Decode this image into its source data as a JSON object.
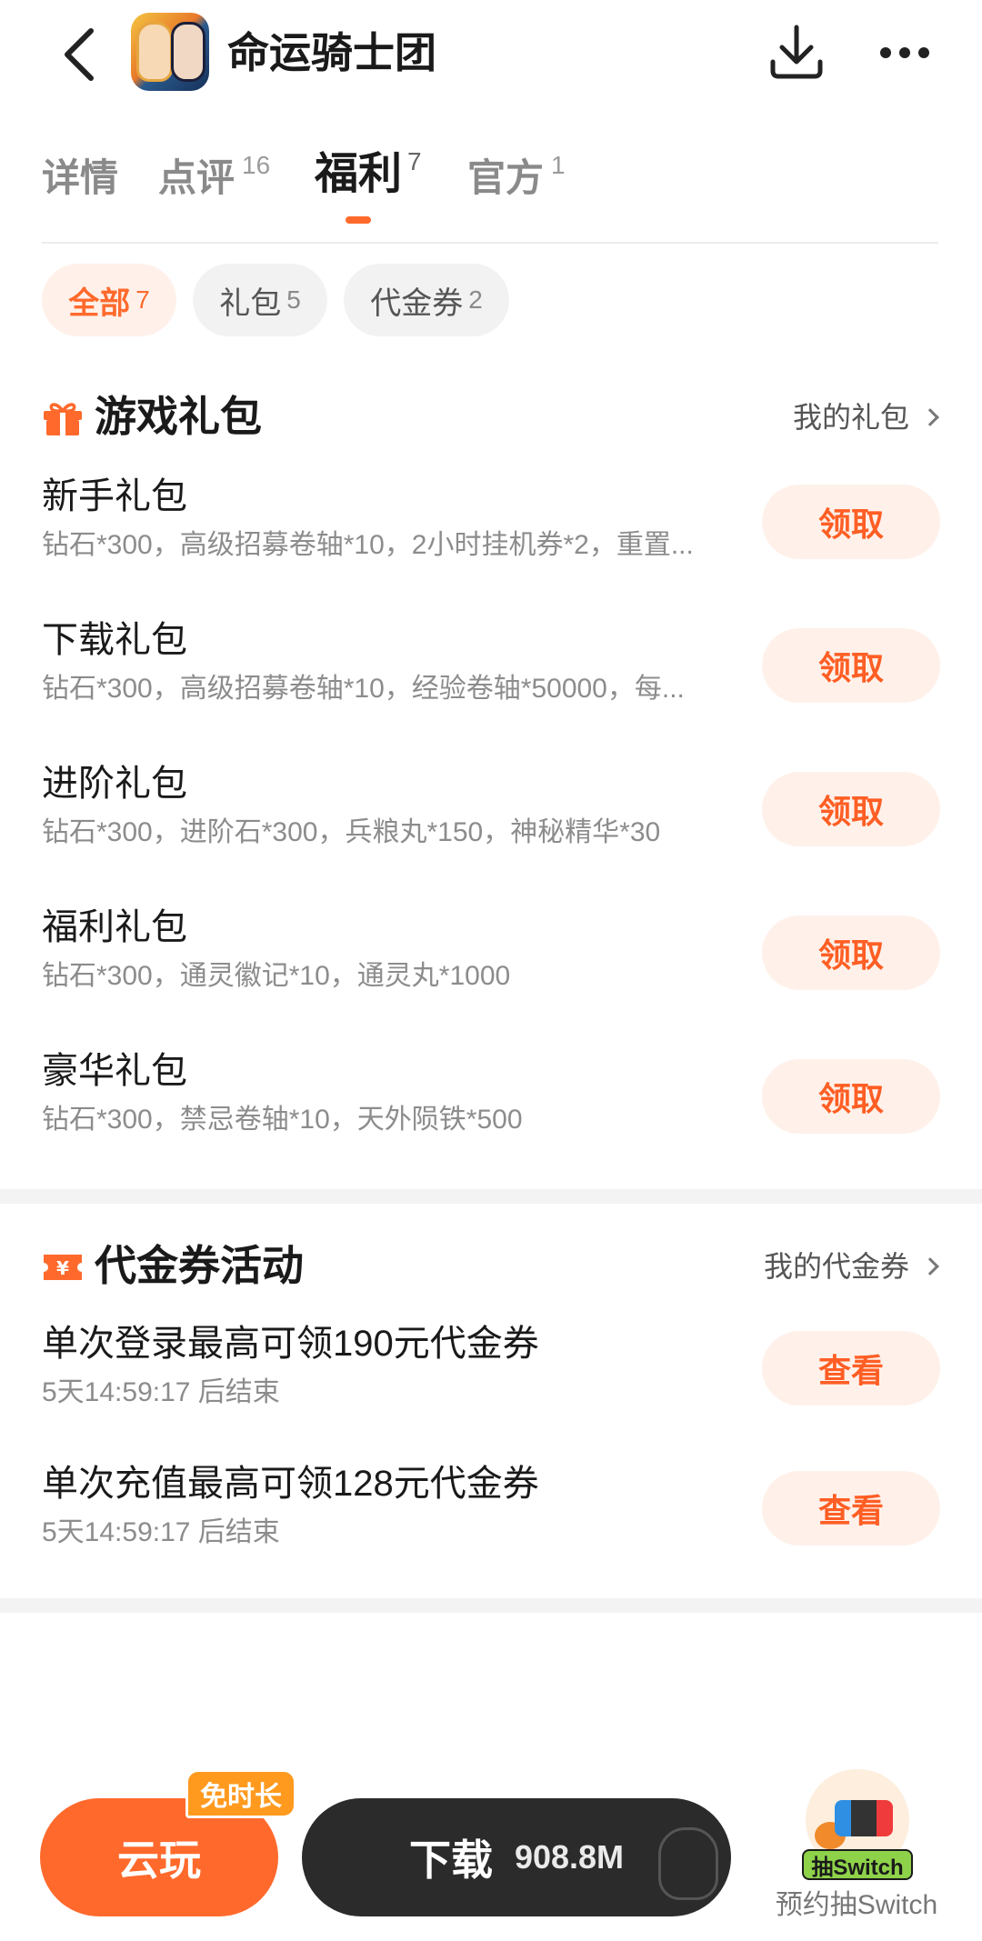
{
  "header": {
    "title": "命运骑士团",
    "icons": {
      "back": "chevron-left-icon",
      "download": "download-icon",
      "more": "more-dots-icon"
    }
  },
  "tabs": [
    {
      "label": "详情",
      "count": ""
    },
    {
      "label": "点评",
      "count": "16"
    },
    {
      "label": "福利",
      "count": "7",
      "active": true
    },
    {
      "label": "官方",
      "count": "1"
    }
  ],
  "filters": [
    {
      "label": "全部",
      "count": "7",
      "active": true
    },
    {
      "label": "礼包",
      "count": "5"
    },
    {
      "label": "代金券",
      "count": "2"
    }
  ],
  "gift_section": {
    "title": "游戏礼包",
    "link": "我的礼包",
    "icon": "gift-icon",
    "items": [
      {
        "name": "新手礼包",
        "desc": "钻石*300，高级招募卷轴*10，2小时挂机券*2，重置...",
        "action": "领取"
      },
      {
        "name": "下载礼包",
        "desc": "钻石*300，高级招募卷轴*10，经验卷轴*50000，每...",
        "action": "领取"
      },
      {
        "name": "进阶礼包",
        "desc": "钻石*300，进阶石*300，兵粮丸*150，神秘精华*30",
        "action": "领取"
      },
      {
        "name": "福利礼包",
        "desc": "钻石*300，通灵徽记*10，通灵丸*1000",
        "action": "领取"
      },
      {
        "name": "豪华礼包",
        "desc": "钻石*300，禁忌卷轴*10，天外陨铁*500",
        "action": "领取"
      }
    ]
  },
  "voucher_section": {
    "title": "代金券活动",
    "link": "我的代金券",
    "icon": "voucher-icon",
    "items": [
      {
        "name": "单次登录最高可领190元代金券",
        "desc": "5天14:59:17 后结束",
        "action": "查看"
      },
      {
        "name": "单次充值最高可领128元代金券",
        "desc": "5天14:59:17 后结束",
        "action": "查看"
      }
    ]
  },
  "bottom_bar": {
    "cloud_label": "云玩",
    "cloud_badge": "免时长",
    "download_label": "下载",
    "download_size": "908.8M",
    "switch_tag": "抽Switch",
    "switch_caption": "预约抽Switch"
  },
  "colors": {
    "accent": "#ff6a2c",
    "accent_light": "#fff1ea",
    "dark_button": "#2b2b2b"
  }
}
